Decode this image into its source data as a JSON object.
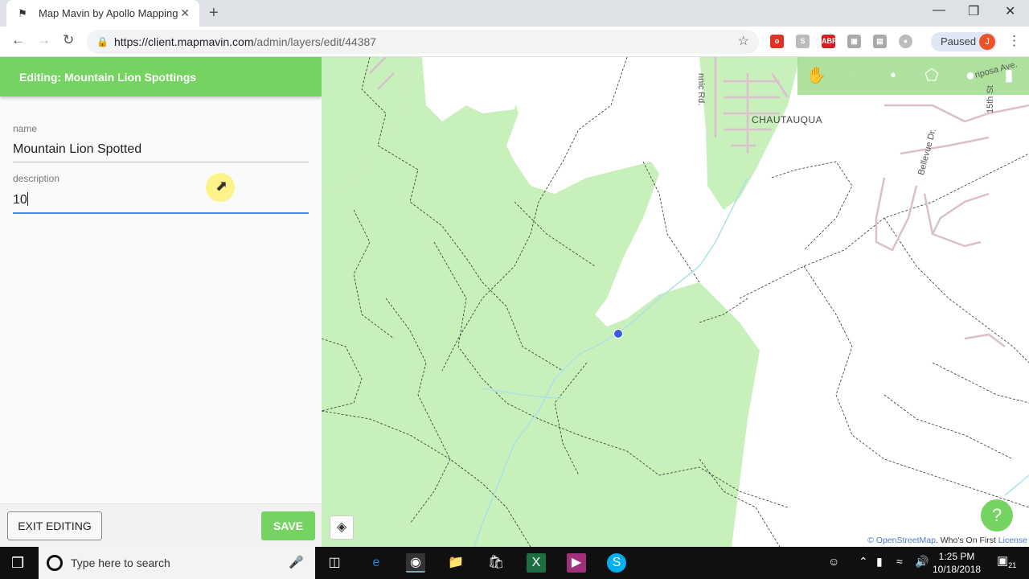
{
  "browser": {
    "tab_title": "Map Mavin by Apollo Mapping",
    "url_host": "https://client.mapmavin.com",
    "url_path": "/admin/layers/edit/44387",
    "profile_status": "Paused",
    "profile_initial": "J"
  },
  "panel": {
    "title": "Editing: Mountain Lion Spottings",
    "fields": [
      {
        "label": "name",
        "value": "Mountain Lion Spotted"
      },
      {
        "label": "description",
        "value": "10"
      }
    ],
    "exit_label": "EXIT EDITING",
    "save_label": "SAVE"
  },
  "map": {
    "labels": {
      "chautauqua": "CHAUTAUQUA",
      "baseline": "nnic Rd.",
      "bellevue": "Bellevue Dr.",
      "mariposa": "riposa Ave.",
      "fifteenth": "15th St"
    },
    "attribution": {
      "osm": "© OpenStreetMap",
      "wof": "Who's On First",
      "license": "License"
    },
    "tools": [
      "pan-hand",
      "select-hand",
      "draw-line",
      "draw-polygon",
      "draw-point",
      "delete"
    ],
    "colors": {
      "park": "#c8f0bb",
      "toolbar": "#75d461",
      "point": "#3b5ee0"
    }
  },
  "taskbar": {
    "search_placeholder": "Type here to search",
    "time": "1:25 PM",
    "date": "10/18/2018",
    "notifications": "21"
  }
}
